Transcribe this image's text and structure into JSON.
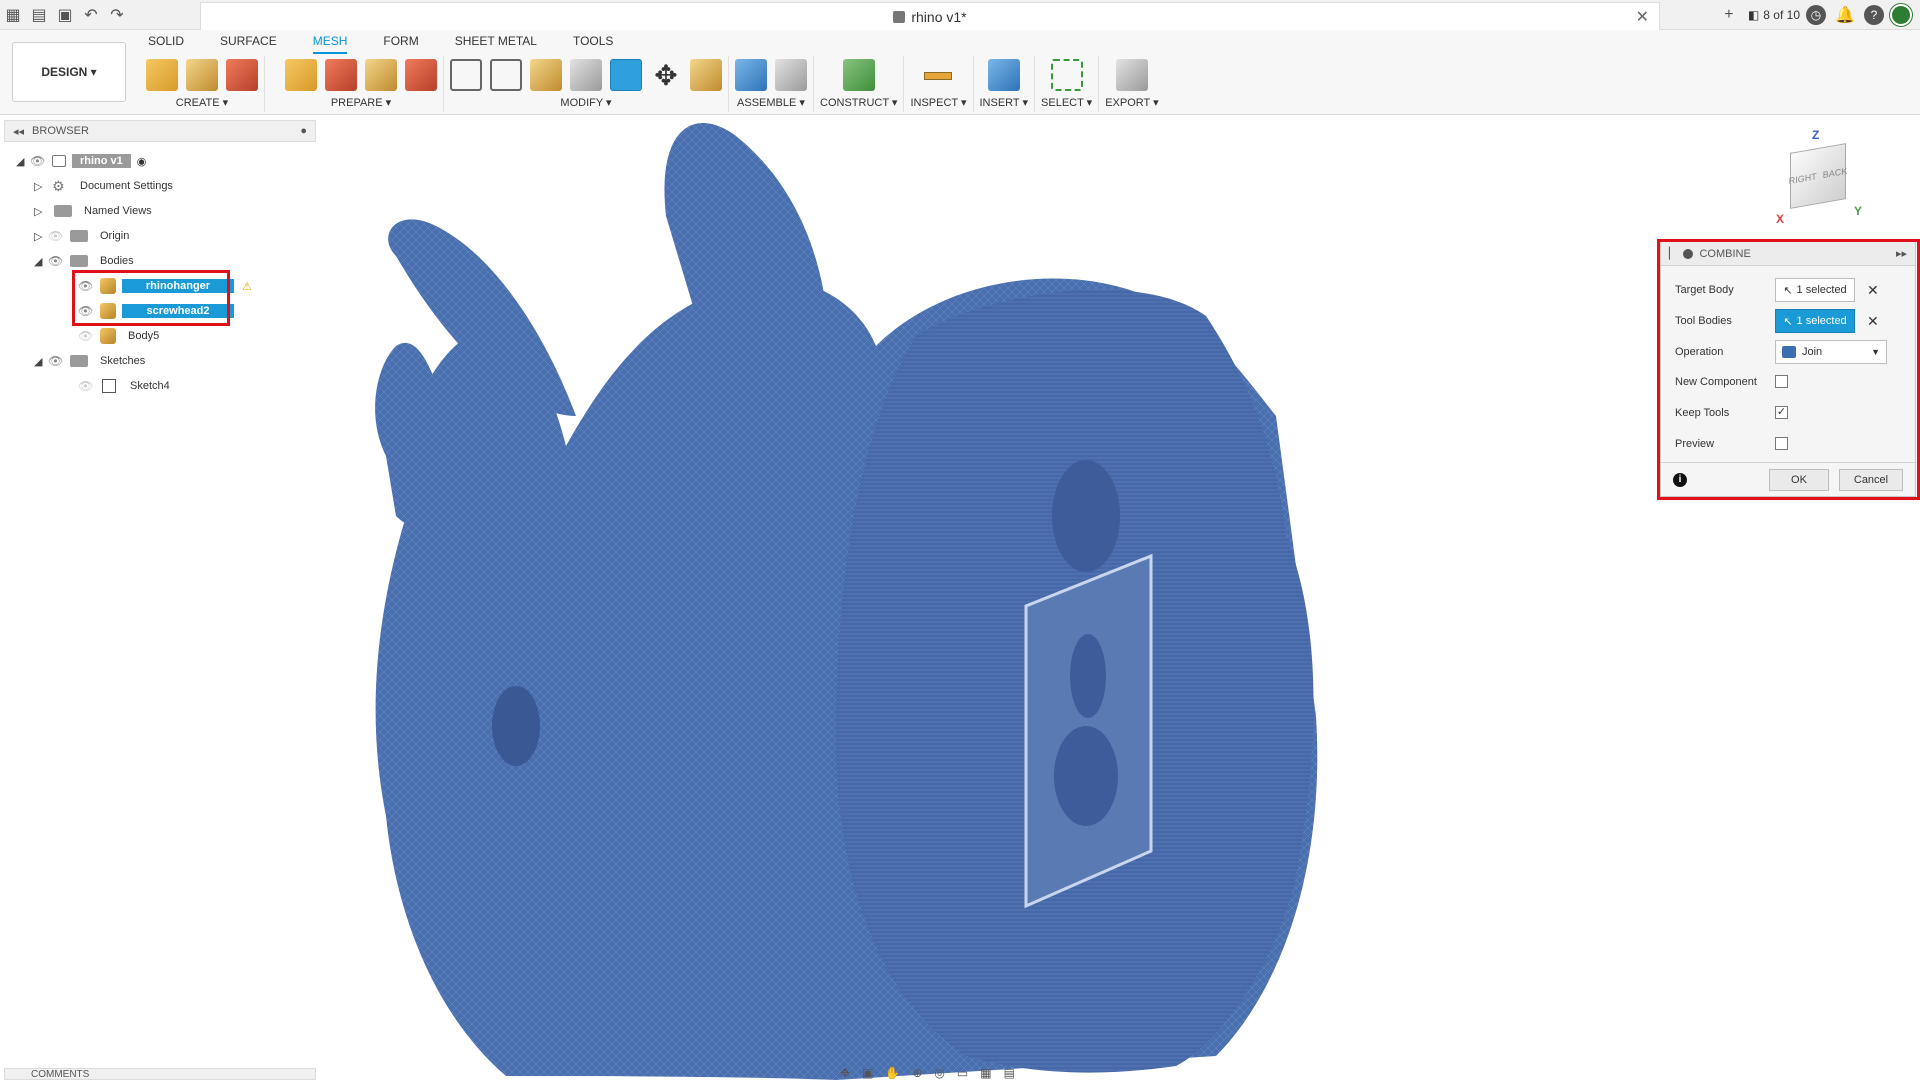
{
  "window": {
    "title": "rhino v1*",
    "page_counter": "8 of 10"
  },
  "ribbon": {
    "workspace_label": "DESIGN ▾",
    "tabs": [
      {
        "label": "SOLID",
        "active": false
      },
      {
        "label": "SURFACE",
        "active": false
      },
      {
        "label": "MESH",
        "active": true
      },
      {
        "label": "FORM",
        "active": false
      },
      {
        "label": "SHEET METAL",
        "active": false
      },
      {
        "label": "TOOLS",
        "active": false
      }
    ],
    "groups": [
      {
        "label": "CREATE ▾"
      },
      {
        "label": "PREPARE ▾"
      },
      {
        "label": "MODIFY ▾"
      },
      {
        "label": "ASSEMBLE ▾"
      },
      {
        "label": "CONSTRUCT ▾"
      },
      {
        "label": "INSPECT ▾"
      },
      {
        "label": "INSERT ▾"
      },
      {
        "label": "SELECT ▾"
      },
      {
        "label": "EXPORT ▾"
      }
    ]
  },
  "browser": {
    "header": "BROWSER",
    "root": "rhino v1",
    "items": {
      "document_settings": "Document Settings",
      "named_views": "Named Views",
      "origin": "Origin",
      "bodies": "Bodies",
      "rhinohanger": "rhinohanger",
      "screwhead2": "screwhead2",
      "body5": "Body5",
      "sketches": "Sketches",
      "sketch4": "Sketch4"
    }
  },
  "viewcube": {
    "right": "RIGHT",
    "back": "BACK",
    "z": "Z",
    "x": "X",
    "y": "Y"
  },
  "combine": {
    "title": "COMBINE",
    "target_body_label": "Target Body",
    "target_body_value": "1 selected",
    "tool_bodies_label": "Tool Bodies",
    "tool_bodies_value": "1 selected",
    "operation_label": "Operation",
    "operation_value": "Join",
    "new_component_label": "New Component",
    "keep_tools_label": "Keep Tools",
    "preview_label": "Preview",
    "ok_label": "OK",
    "cancel_label": "Cancel",
    "new_component_checked": false,
    "keep_tools_checked": true,
    "preview_checked": false
  },
  "comments": {
    "label": "COMMENTS"
  },
  "colors": {
    "accent": "#0696d7",
    "selection": "#1a9ad6",
    "highlight": "#e0101b",
    "mesh": "#4a6fae"
  }
}
